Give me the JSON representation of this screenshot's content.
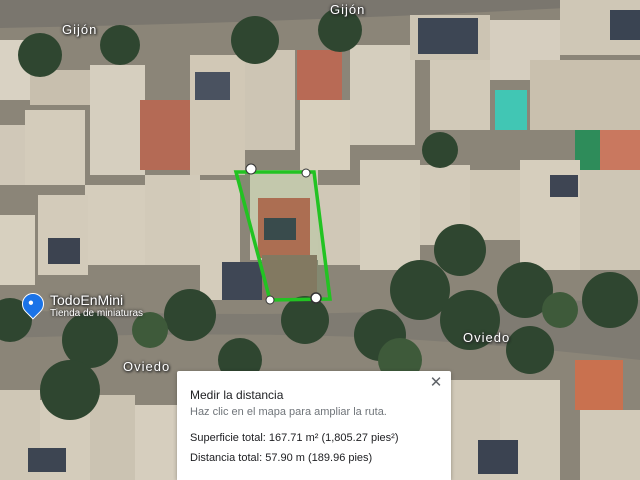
{
  "map": {
    "streets": [
      {
        "name": "Gijón"
      },
      {
        "name": "Gijón"
      },
      {
        "name": "Oviedo"
      },
      {
        "name": "Oviedo"
      }
    ],
    "poi": {
      "name": "TodoEnMini",
      "category": "Tienda de miniaturas",
      "icon": "shopping-bag-icon"
    },
    "measure_color": "#22c322"
  },
  "measure_panel": {
    "title": "Medir la distancia",
    "hint": "Haz clic en el mapa para ampliar la ruta.",
    "area": "Superficie total: 167.71 m² (1,805.27 pies²)",
    "distance": "Distancia total: 57.90 m (189.96 pies)",
    "close_icon": "close-icon"
  }
}
